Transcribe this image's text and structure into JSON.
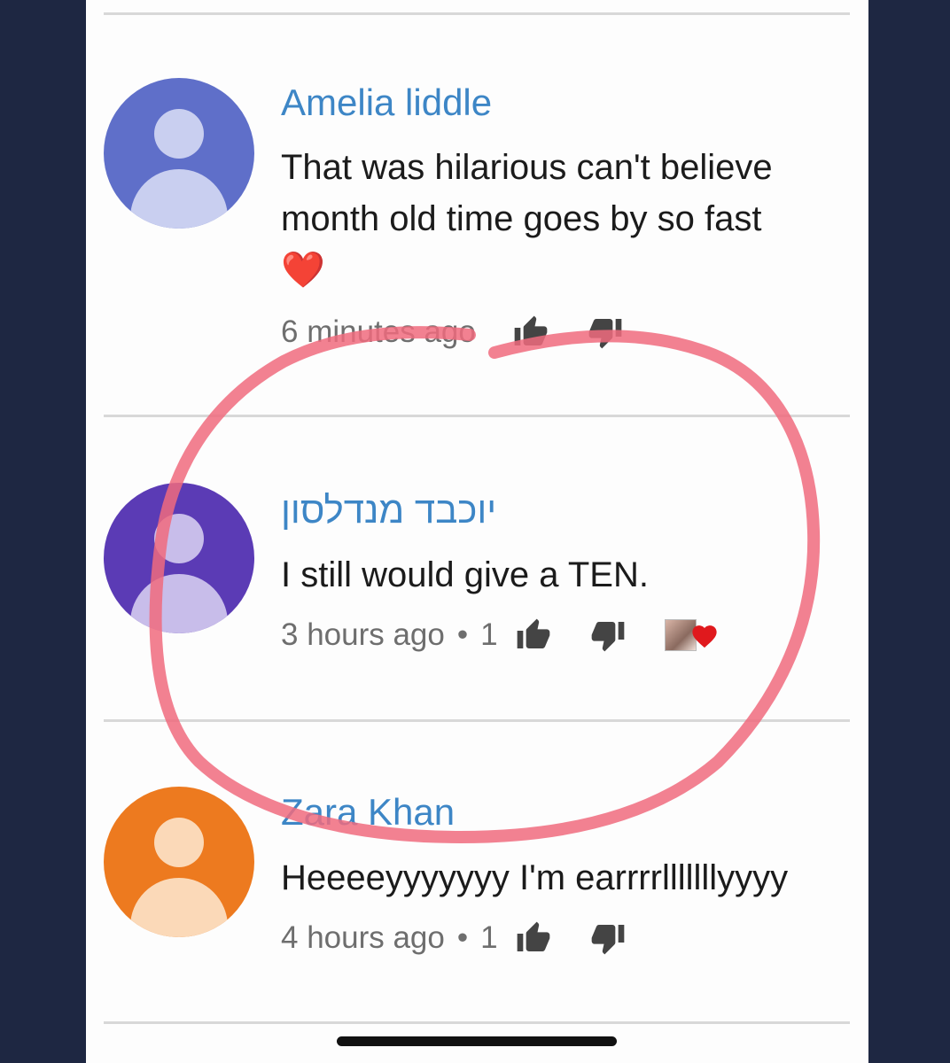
{
  "comments": [
    {
      "author": "Amelia liddle",
      "text": "That was hilarious can't believe month old time goes by so fast",
      "emoji": "❤️",
      "time": "6 minutes ago",
      "avatar_color": "#5f6fc9",
      "avatar_fg": "#c9cff0"
    },
    {
      "author": "יוכבד מנדלסון",
      "text": "I still would give a TEN.",
      "time": "3 hours ago",
      "separator": "•",
      "likes": "1",
      "hearted": true,
      "avatar_color": "#5b3bb5",
      "avatar_fg": "#c8bdea"
    },
    {
      "author": "Zara Khan",
      "text": "Heeeeyyyyyyy I'm earrrrlllllllyyyy",
      "time": "4 hours ago",
      "separator": "•",
      "likes": "1",
      "avatar_color": "#ed7a1f",
      "avatar_fg": "#fbd9b8"
    }
  ],
  "annotation_color": "#f06b7e"
}
